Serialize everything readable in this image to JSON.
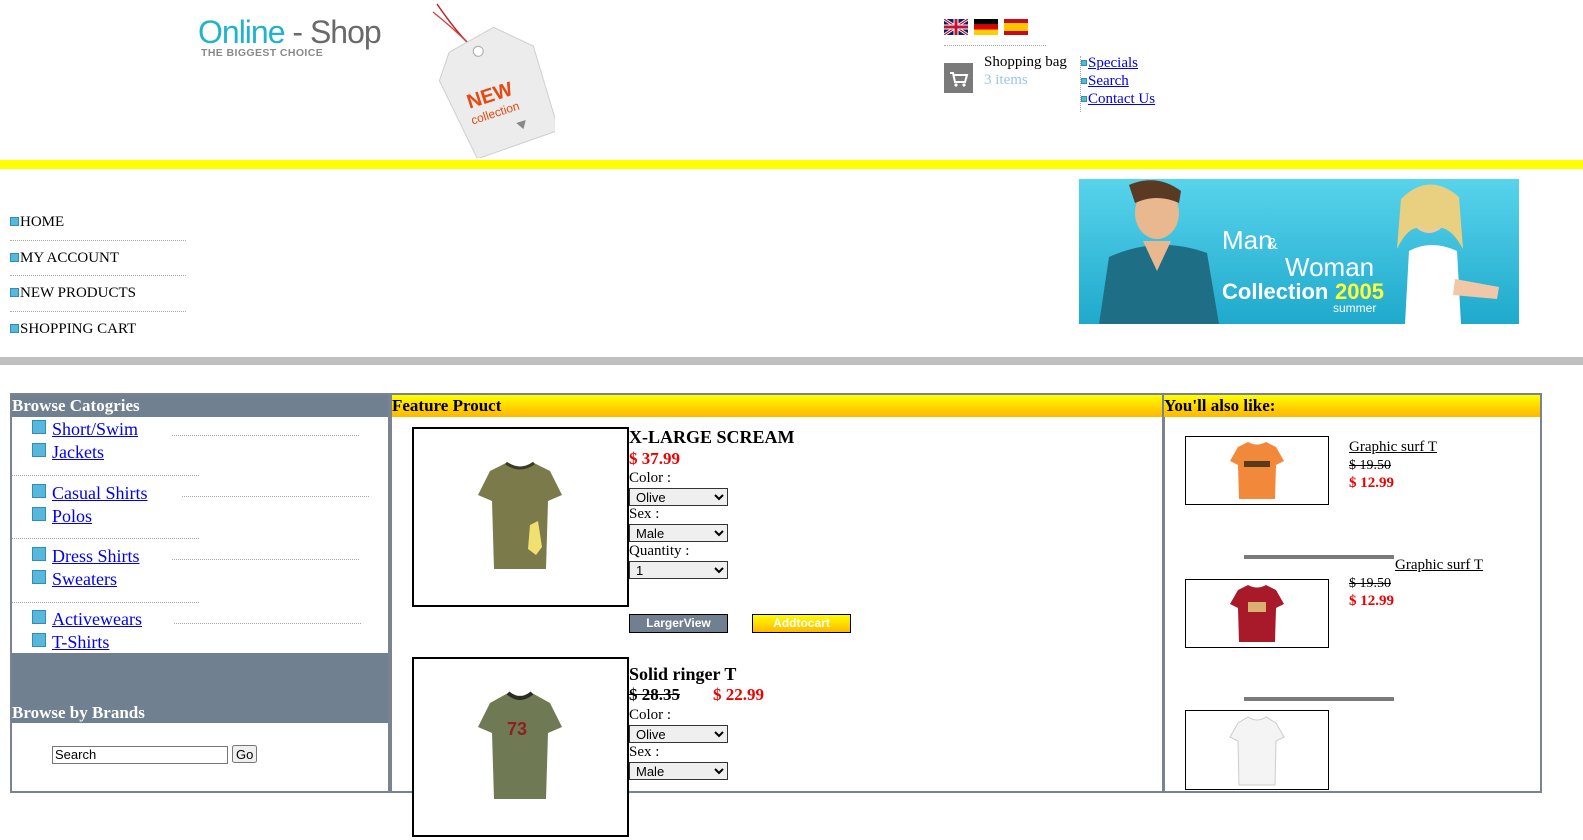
{
  "header": {
    "logo": {
      "part1": "Online",
      "dash": " - ",
      "part2": "Shop",
      "tagline": "THE BIGGEST CHOICE"
    },
    "tag_text": {
      "line1": "NEW",
      "line2": "collection"
    },
    "flags": [
      "flag-uk-icon",
      "flag-de-icon",
      "flag-es-icon"
    ],
    "bag": {
      "label": "Shopping bag",
      "count": "3 items"
    },
    "links": [
      {
        "label": "Specials"
      },
      {
        "label": "Search"
      },
      {
        "label": "Contact Us"
      }
    ]
  },
  "nav": {
    "items": [
      {
        "label": "HOME"
      },
      {
        "label": "MY ACCOUNT"
      },
      {
        "label": "NEW PRODUCTS"
      },
      {
        "label": "SHOPPING CART"
      }
    ]
  },
  "banner": {
    "line1": "Man",
    "amp": "&",
    "line2": "Woman",
    "line3": "Collection",
    "year": "2005",
    "season": "summer"
  },
  "categories": {
    "title": "Browse Catogries",
    "items": [
      {
        "label": "Short/Swim"
      },
      {
        "label": "Jackets"
      },
      {
        "label": "Casual Shirts"
      },
      {
        "label": "Polos"
      },
      {
        "label": "Dress Shirts"
      },
      {
        "label": "Sweaters"
      },
      {
        "label": "Activewears"
      },
      {
        "label": "T-Shirts"
      }
    ]
  },
  "brands": {
    "title": "Browse by Brands",
    "search_value": "Search",
    "go_label": "Go"
  },
  "feature": {
    "title": "Feature Prouct",
    "products": [
      {
        "name": "X-LARGE SCREAM",
        "price": "$ 37.99",
        "color_label": "Color :",
        "color_value": "Olive",
        "sex_label": "Sex :",
        "sex_value": "Male",
        "qty_label": "Quantity :",
        "qty_value": "1",
        "larger_label": "LargerView",
        "add_label": "Addtocart",
        "shirt_color": "#7a7a4a"
      },
      {
        "name": "Solid ringer T",
        "old_price": "$ 28.35",
        "price": "$ 22.99",
        "color_label": "Color :",
        "color_value": "Olive",
        "sex_label": "Sex :",
        "sex_value": "Male",
        "shirt_color": "#6f7a55"
      }
    ]
  },
  "also": {
    "title": "You'll also like:",
    "items": [
      {
        "name": "Graphic surf T",
        "old_price": "$ 19.50",
        "price": "$ 12.99",
        "shirt_color": "#f2883a"
      },
      {
        "name": "Graphic surf T",
        "old_price": "$ 19.50",
        "price": "$ 12.99",
        "shirt_color": "#a8192a"
      },
      {
        "shirt_color": "#f4f4f4"
      }
    ]
  },
  "colors": {
    "yellow_bar": "#ffff00",
    "slate": "#708090",
    "price_red": "#ee0000",
    "brand_blue": "#21b3cc"
  }
}
